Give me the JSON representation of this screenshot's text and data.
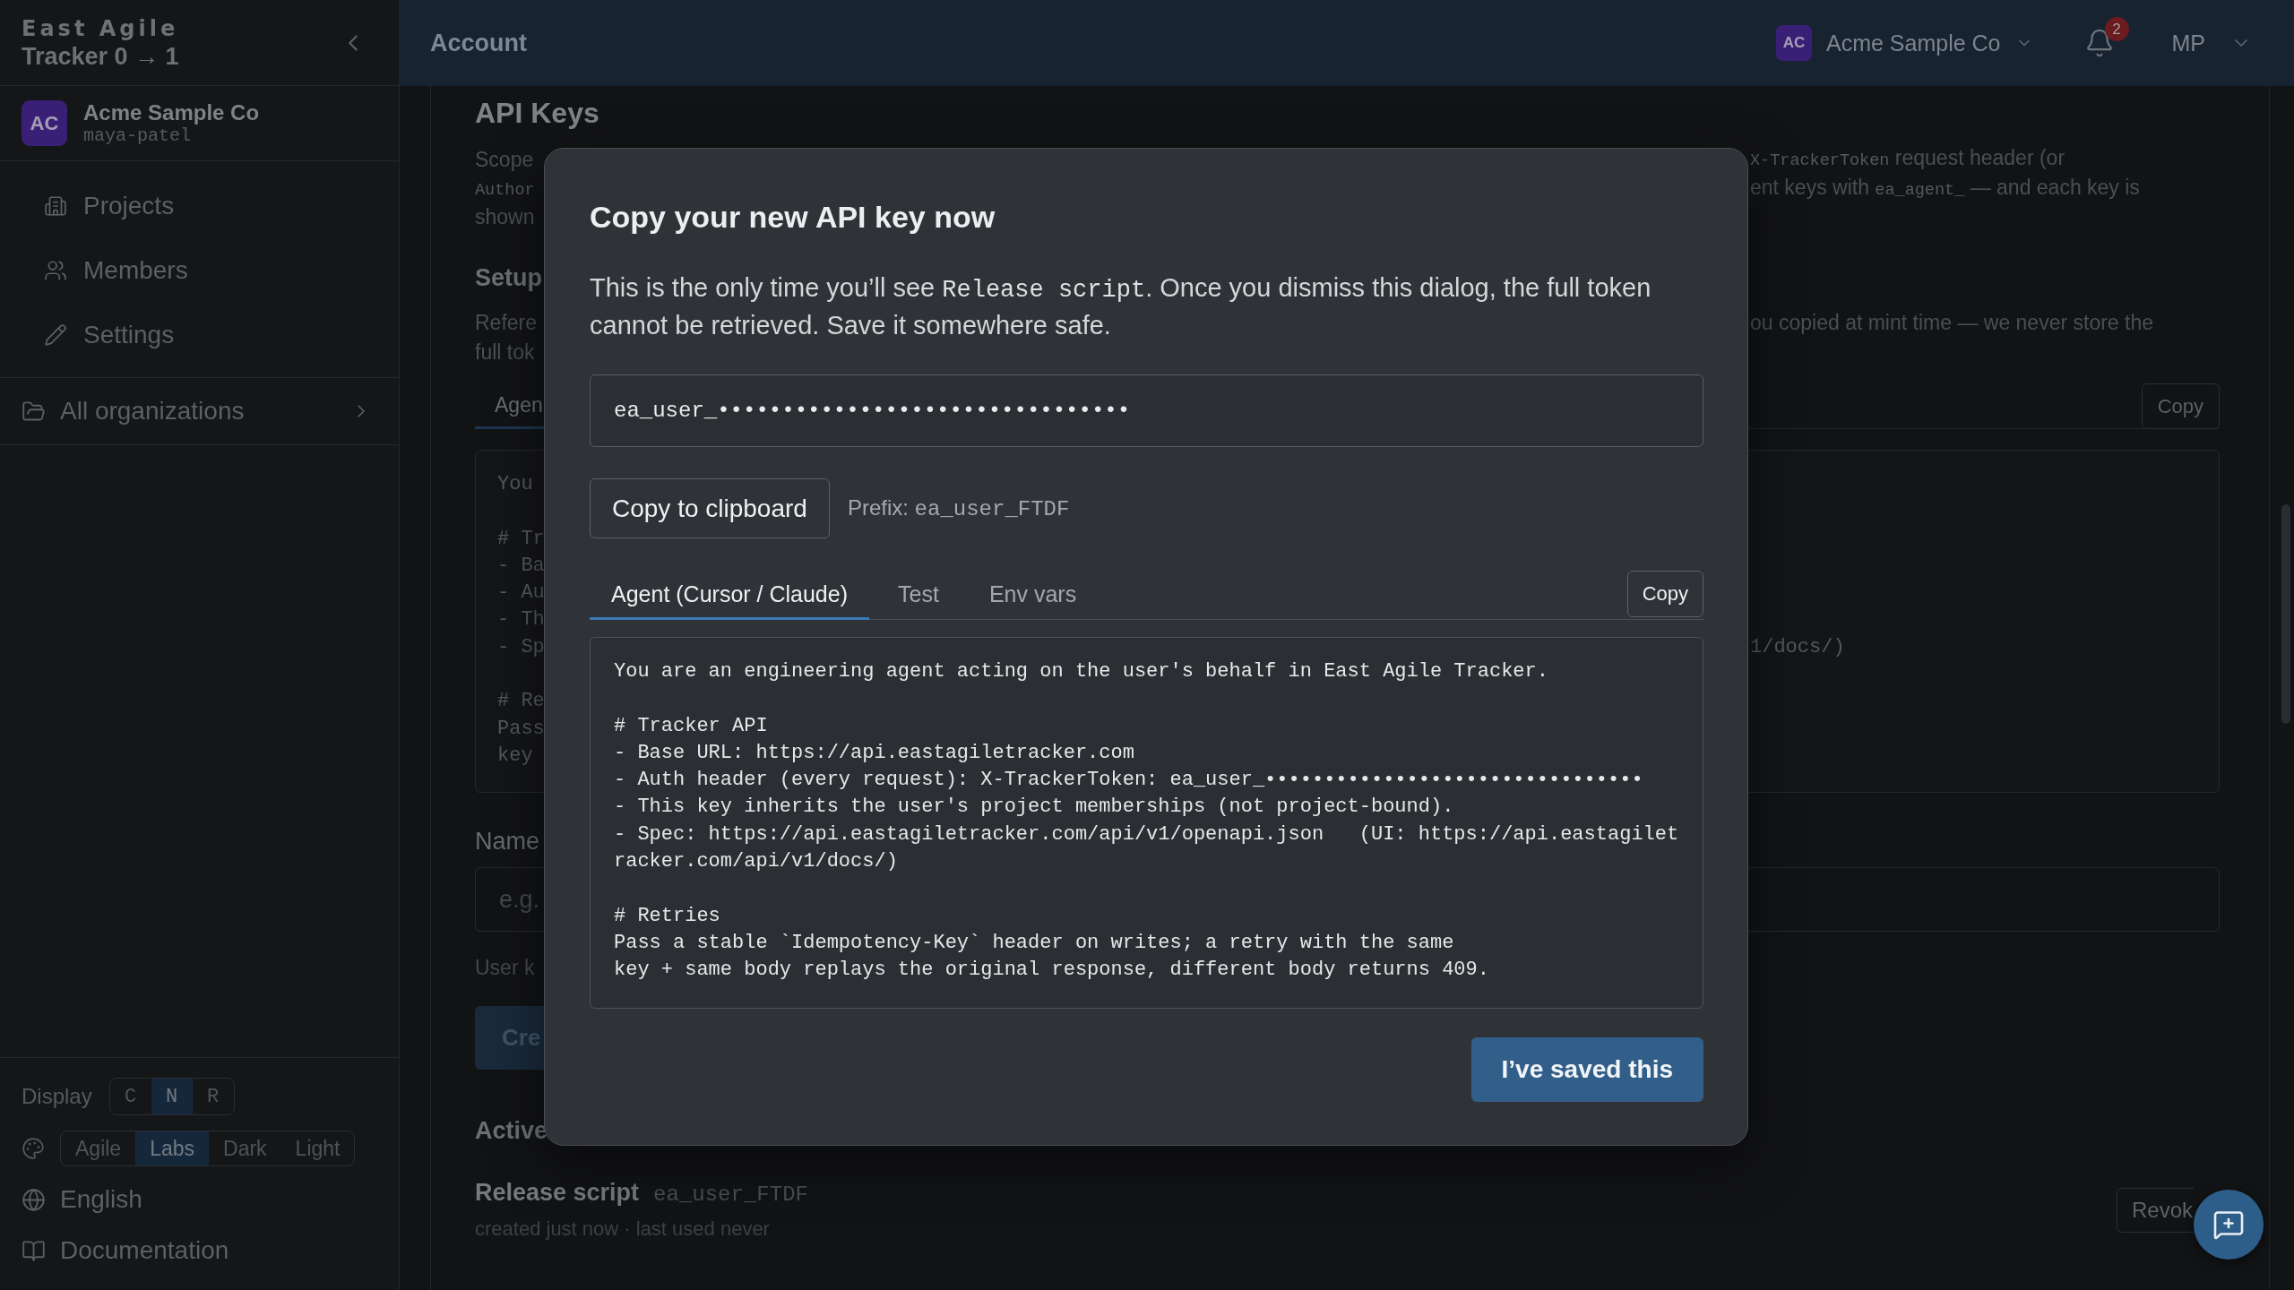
{
  "sidebar": {
    "logo_title": "East Agile",
    "logo_subtitle": "Tracker 0 → 1",
    "org": {
      "initials": "AC",
      "name": "Acme Sample Co",
      "handle": "maya-patel"
    },
    "nav": [
      {
        "label": "Projects"
      },
      {
        "label": "Members"
      },
      {
        "label": "Settings"
      }
    ],
    "all_organizations": "All organizations",
    "display": {
      "label": "Display",
      "options": [
        {
          "label": "C",
          "selected": false
        },
        {
          "label": "N",
          "selected": true
        },
        {
          "label": "R",
          "selected": false
        }
      ]
    },
    "theme": {
      "options": [
        {
          "label": "Agile",
          "selected": false
        },
        {
          "label": "Labs",
          "selected": true
        },
        {
          "label": "Dark",
          "selected": false
        },
        {
          "label": "Light",
          "selected": false
        }
      ]
    },
    "language": "English",
    "documentation": "Documentation"
  },
  "topbar": {
    "title": "Account",
    "org": {
      "initials": "AC",
      "name": "Acme Sample Co"
    },
    "notification_count": "2",
    "user_initials": "MP"
  },
  "page": {
    "title": "API Keys",
    "intro_lines": [
      {
        "left": [
          {
            "kind": "text",
            "text": "Scope"
          }
        ],
        "right": [
          {
            "kind": "code",
            "text": "X-TrackerToken"
          },
          {
            "kind": "text",
            "text": " request header (or"
          }
        ]
      },
      {
        "left": [
          {
            "kind": "code",
            "text": "Author"
          }
        ],
        "right": [
          {
            "kind": "text",
            "text": "ent keys with "
          },
          {
            "kind": "code",
            "text": "ea_agent_"
          },
          {
            "kind": "text",
            "text": " — and each key is"
          }
        ]
      },
      {
        "left": [
          {
            "kind": "text",
            "text": "shown"
          }
        ]
      }
    ],
    "setup": {
      "heading": "Setup",
      "lines": [
        {
          "left": [
            {
              "kind": "text",
              "text": "Refere"
            }
          ],
          "right": [
            {
              "kind": "text",
              "text": "ou copied at mint time — we never store the"
            }
          ]
        },
        {
          "left": [
            {
              "kind": "text",
              "text": "full tok"
            }
          ]
        }
      ],
      "tabs": [
        {
          "label": "Agen",
          "selected": true
        }
      ],
      "copy_button": "Copy",
      "code_blocks": [
        [
          {
            "left": "You"
          }
        ],
        [
          {
            "left": "# Tr"
          },
          {
            "left": "- Ba"
          },
          {
            "left": "- Au"
          },
          {
            "left": "- Th"
          },
          {
            "left": "- Sp",
            "right": "1/docs/)"
          }
        ],
        [
          {
            "left": "# Re"
          },
          {
            "left": "Pass"
          },
          {
            "left": "key"
          }
        ]
      ]
    },
    "name_field": {
      "label": "Name",
      "placeholder": "e.g.",
      "hint": "User k"
    },
    "create_button": "Cre",
    "active_heading": "Active",
    "keys": [
      {
        "name": "Release script",
        "prefix": "ea_user_FTDF",
        "meta": "created just now · last used never",
        "action": "Revok"
      }
    ]
  },
  "modal": {
    "title": "Copy your new API key now",
    "message": [
      {
        "kind": "text",
        "text": "This is the only time you’ll see "
      },
      {
        "kind": "code",
        "text": "Release script"
      },
      {
        "kind": "text",
        "text": ". Once you dismiss this dialog, the full token cannot be retrieved. Save it somewhere safe."
      }
    ],
    "token": "ea_user_••••••••••••••••••••••••••••••••",
    "copy_button": "Copy to clipboard",
    "prefix": {
      "label": "Prefix: ",
      "value": "ea_user_FTDF"
    },
    "tabs": [
      {
        "label": "Agent (Cursor / Claude)",
        "selected": true
      },
      {
        "label": "Test",
        "selected": false
      },
      {
        "label": "Env vars",
        "selected": false
      }
    ],
    "copy_snippet_button": "Copy",
    "snippet": "You are an engineering agent acting on the user's behalf in East Agile Tracker.\n\n# Tracker API\n- Base URL: https://api.eastagiletracker.com\n- Auth header (every request): X-TrackerToken: ea_user_••••••••••••••••••••••••••••••••\n- This key inherits the user's project memberships (not project-bound).\n- Spec: https://api.eastagiletracker.com/api/v1/openapi.json   (UI: https://api.eastagiletracker.com/api/v1/docs/)\n\n# Retries\nPass a stable `Idempotency-Key` header on writes; a retry with the same\nkey + same body replays the original response, different body returns 409.",
    "confirm_button": "I’ve saved this"
  }
}
